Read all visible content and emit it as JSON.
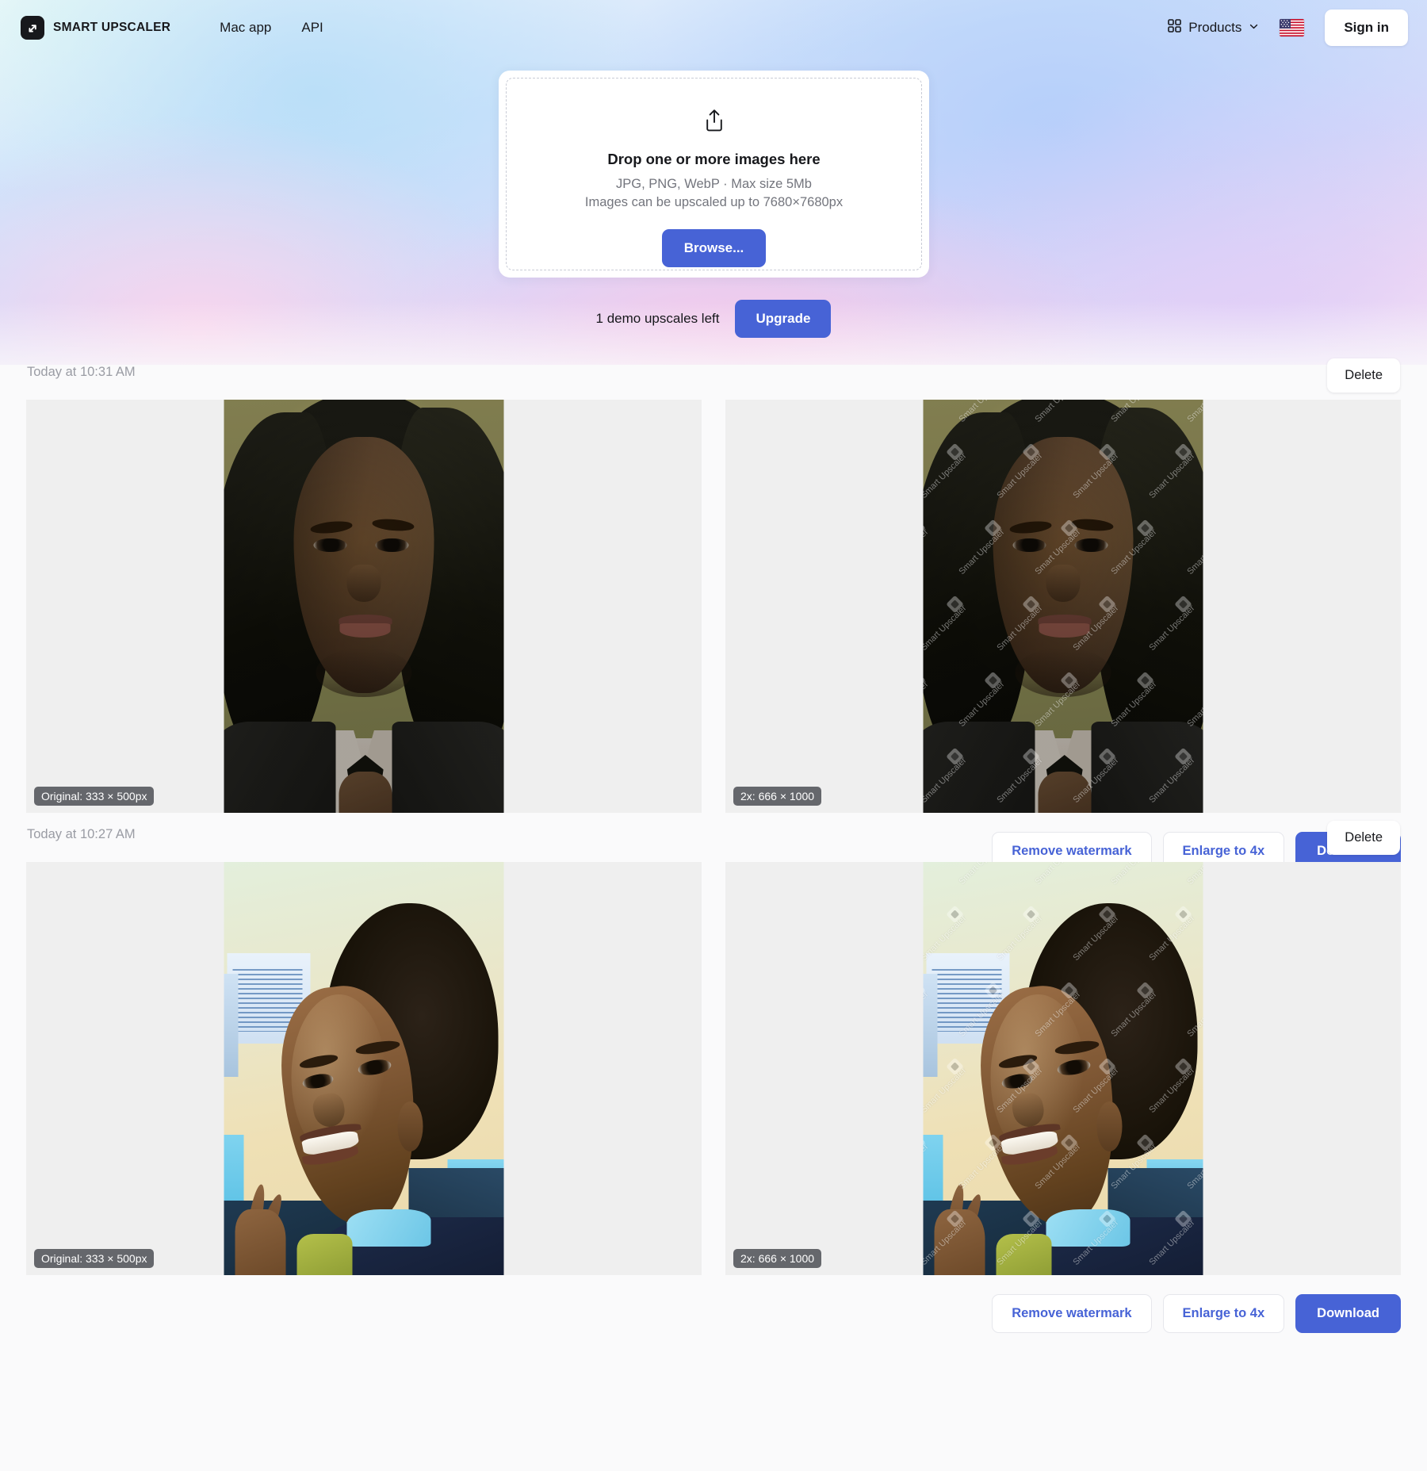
{
  "header": {
    "logo_text": "SMART UPSCALER",
    "logo_icon": "expand-arrow-icon",
    "nav": [
      {
        "label": "Mac app",
        "name": "nav-mac-app"
      },
      {
        "label": "API",
        "name": "nav-api"
      }
    ],
    "products_label": "Products",
    "products_icon": "grid-icon",
    "chevron_icon": "chevron-down-icon",
    "language_flag": "us-flag-icon",
    "signin_label": "Sign in"
  },
  "dropzone": {
    "upload_icon": "upload-share-icon",
    "title": "Drop one or more images here",
    "formats_line": "JPG, PNG, WebP · Max size 5Mb",
    "limit_line": "Images can be upscaled up to 7680×7680px",
    "browse_label": "Browse..."
  },
  "demo": {
    "counter_text": "1 demo upscales left",
    "upgrade_label": "Upgrade"
  },
  "colors": {
    "accent": "#4763d6",
    "page_bg": "#fafafb",
    "pane_bg": "#efefef",
    "badge_bg": "#5a5c62",
    "text": "#17181c",
    "muted": "#9a9ca4"
  },
  "actions": {
    "remove_watermark": "Remove watermark",
    "enlarge": "Enlarge to 4x",
    "download": "Download",
    "delete": "Delete"
  },
  "watermark_text": "Smart Upscaler",
  "results": [
    {
      "timestamp": "Today at 10:31 AM",
      "original_badge": "Original: 333 × 500px",
      "upscaled_badge": "2x: 666 × 1000",
      "photo": "A"
    },
    {
      "timestamp": "Today at 10:27 AM",
      "original_badge": "Original: 333 × 500px",
      "upscaled_badge": "2x: 666 × 1000",
      "photo": "B"
    }
  ]
}
